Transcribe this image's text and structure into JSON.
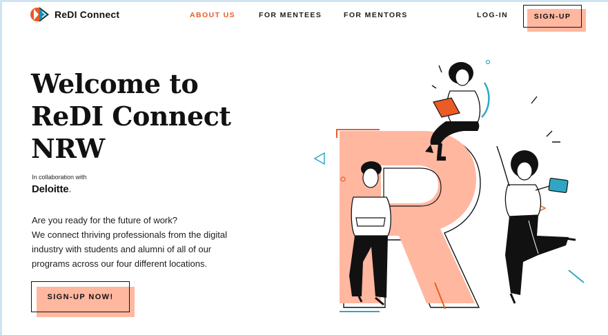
{
  "brand": {
    "name": "ReDI Connect"
  },
  "nav": {
    "links": [
      {
        "label": "ABOUT US"
      },
      {
        "label": "FOR MENTEES"
      },
      {
        "label": "FOR MENTORS"
      }
    ],
    "login_label": "LOG-IN",
    "signup_label": "SIGN-UP"
  },
  "hero": {
    "title_line1": "Welcome to",
    "title_line2": "ReDI Connect",
    "title_line3": "NRW",
    "collab_text": "In collaboration with",
    "partner_name": "Deloitte",
    "partner_dot": ".",
    "desc_line1": "Are you ready for the future of work?",
    "desc_line2": "We connect thriving professionals from the digital",
    "desc_line3": "industry with students and alumni of all of our",
    "desc_line4": "programs across our four different locations.",
    "cta_label": "SIGN-UP NOW!"
  },
  "colors": {
    "accent": "#ea5b25",
    "salmon": "#ffb7a0",
    "teal": "#2fa7c4",
    "deloitte_green": "#86bc25"
  }
}
